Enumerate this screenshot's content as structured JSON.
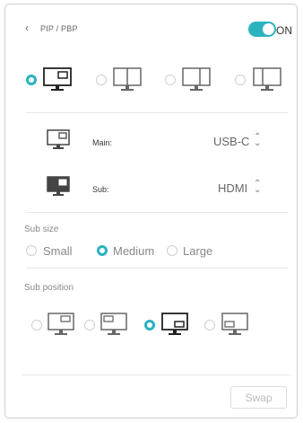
{
  "header": {
    "back_glyph": "‹",
    "title": "PIP / PBP",
    "toggle_label": "ON",
    "toggle_on": true
  },
  "layout_modes": {
    "selected_index": 0,
    "options": [
      {
        "icon": "pip-monitor-icon"
      },
      {
        "icon": "pbp-vertical-split-monitor-icon"
      },
      {
        "icon": "pbp-split-monitor-icon"
      },
      {
        "icon": "pbp-triple-monitor-icon"
      }
    ]
  },
  "sources": {
    "main": {
      "label": "Main:",
      "value": "USB-C",
      "chevron": "⌃⌄"
    },
    "sub": {
      "label": "Sub:",
      "value": "HDMI",
      "chevron": "⌃⌄"
    }
  },
  "sub_size": {
    "title": "Sub size",
    "selected": "Medium",
    "options": [
      "Small",
      "Medium",
      "Large"
    ]
  },
  "sub_position": {
    "title": "Sub position",
    "selected_index": 2,
    "options": [
      {
        "icon": "top-left-position-icon"
      },
      {
        "icon": "top-right-position-icon"
      },
      {
        "icon": "bottom-right-position-icon"
      },
      {
        "icon": "bottom-left-position-icon"
      }
    ]
  },
  "footer": {
    "swap_label": "Swap"
  },
  "colors": {
    "accent": "#2bb3c0"
  }
}
